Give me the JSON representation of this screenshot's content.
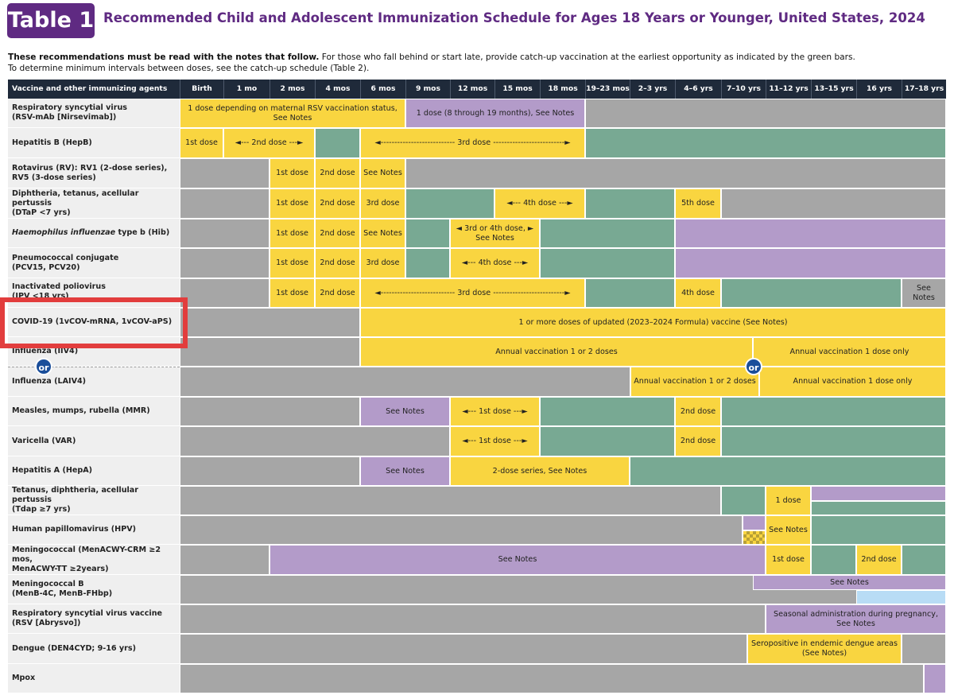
{
  "header": {
    "tag": "Table 1",
    "title": "Recommended Child and Adolescent Immunization Schedule for Ages 18 Years or Younger, United States, 2024",
    "notes_bold": "These recommendations must be read with the notes that follow.",
    "notes_rest": " For those who fall behind or start late, provide catch-up vaccination at the earliest opportunity as indicated by the green bars.",
    "notes_line2": "To determine minimum intervals between doses, see the catch-up schedule (Table 2)."
  },
  "columns": [
    "Vaccine and other immunizing agents",
    "Birth",
    "1 mo",
    "2 mos",
    "4 mos",
    "6 mos",
    "9 mos",
    "12 mos",
    "15 mos",
    "18 mos",
    "19–23 mos",
    "2–3 yrs",
    "4–6 yrs",
    "7–10 yrs",
    "11–12 yrs",
    "13–15 yrs",
    "16 yrs",
    "17–18 yrs"
  ],
  "rows": [
    {
      "id": "rsv",
      "name": [
        "Respiratory syncytial virus",
        "(RSV-mAb [Nirsevimab])"
      ]
    },
    {
      "id": "hepb",
      "name": [
        "Hepatitis B (HepB)"
      ]
    },
    {
      "id": "rota",
      "name": [
        "Rotavirus (RV): RV1 (2-dose series),",
        "RV5 (3-dose series)"
      ]
    },
    {
      "id": "dtap",
      "name": [
        "Diphtheria, tetanus, acellular pertussis",
        "(DTaP <7 yrs)"
      ]
    },
    {
      "id": "hib",
      "name_italic": "Haemophilus influenzae",
      "name_rest": " type b (Hib)"
    },
    {
      "id": "pcv",
      "name": [
        "Pneumococcal conjugate",
        "(PCV15, PCV20)"
      ]
    },
    {
      "id": "ipv",
      "name": [
        "Inactivated poliovirus",
        "(IPV <18 yrs)"
      ]
    },
    {
      "id": "covid",
      "name": [
        "COVID-19 (1vCOV-mRNA, 1vCOV-aPS)"
      ]
    },
    {
      "id": "flu_iiv",
      "name": [
        "Influenza (IIV4)"
      ]
    },
    {
      "id": "flu_laiv",
      "name": [
        "Influenza (LAIV4)"
      ]
    },
    {
      "id": "mmr",
      "name": [
        "Measles, mumps, rubella (MMR)"
      ]
    },
    {
      "id": "var",
      "name": [
        "Varicella (VAR)"
      ]
    },
    {
      "id": "hepa",
      "name": [
        "Hepatitis A (HepA)"
      ]
    },
    {
      "id": "tdap",
      "name": [
        "Tetanus, diphtheria, acellular pertussis",
        "(Tdap ≥7 yrs)"
      ]
    },
    {
      "id": "hpv",
      "name": [
        "Human papillomavirus (HPV)"
      ]
    },
    {
      "id": "menacwy",
      "name": [
        "Meningococcal (MenACWY-CRM ≥2 mos,",
        "MenACWY-TT ≥2years)"
      ]
    },
    {
      "id": "menb",
      "name": [
        "Meningococcal B",
        "(MenB-4C, MenB-FHbp)"
      ]
    },
    {
      "id": "rsv_vac",
      "name": [
        "Respiratory syncytial virus vaccine",
        "(RSV [Abrysvo])"
      ]
    },
    {
      "id": "dengue",
      "name": [
        "Dengue (DEN4CYD; 9-16 yrs)"
      ]
    },
    {
      "id": "mpox",
      "name": [
        "Mpox"
      ]
    }
  ],
  "labels": {
    "rsv_mat": "1 dose depending on maternal RSV vaccination status, See Notes",
    "rsv_8_19": "1 dose (8 through 19 months), See Notes",
    "d1": "1st dose",
    "d2": "2nd dose",
    "d3": "3rd dose",
    "d4": "4th dose",
    "d5": "5th dose",
    "hepb_2": "◄--- 2nd dose ---►",
    "hepb_3": "◄--------------------------- 3rd dose --------------------------►",
    "see_notes": "See Notes",
    "dtap_4": "◄--- 4th dose ---►",
    "hib_34": "◄ 3rd or 4th dose, ► See Notes",
    "pcv_4": "◄--- 4th dose ---►",
    "ipv_3": "◄--------------------------- 3rd dose --------------------------►",
    "covid": "1 or more doses of updated (2023–2024 Formula) vaccine (See Notes)",
    "annual_12": "Annual vaccination 1 or 2 doses",
    "annual_1": "Annual vaccination 1 dose only",
    "or": "or",
    "mmr_1": "◄--- 1st dose ---►",
    "var_1": "◄--- 1st dose ---►",
    "hepa_2": "2-dose series, See Notes",
    "tdap_1": "1 dose",
    "rsv_preg": "Seasonal administration during pregnancy, See Notes",
    "dengue": "Seropositive in endemic dengue areas (See Notes)"
  },
  "colors": {
    "yellow": "#f9d540",
    "green": "#78a993",
    "purple": "#b39bc9",
    "gray": "#a6a6a6",
    "blue": "#b8dcf5",
    "header": "#1f2a3a",
    "title_purple": "#5f2a82",
    "highlight_red": "#e23d3d"
  },
  "highlighted_row": "covid"
}
